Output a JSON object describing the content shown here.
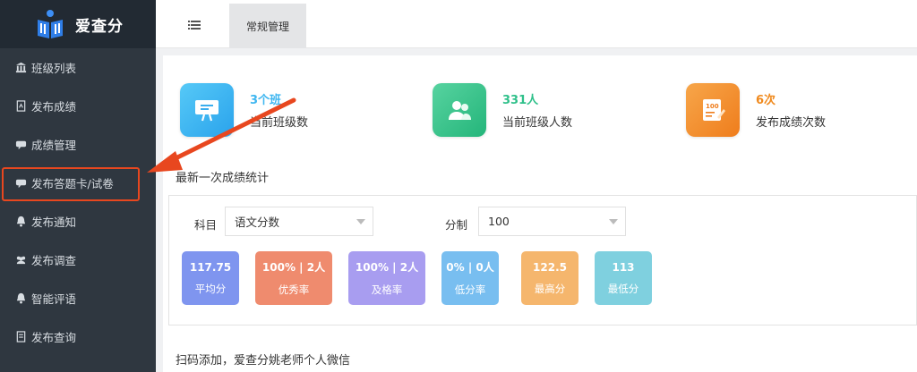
{
  "app": {
    "name": "爱查分"
  },
  "sidebar": {
    "items": [
      {
        "label": "班级列表",
        "icon": "bank-icon"
      },
      {
        "label": "发布成绩",
        "icon": "document-icon"
      },
      {
        "label": "成绩管理",
        "icon": "speech-bubble-icon"
      },
      {
        "label": "发布答题卡/试卷",
        "icon": "speech-bubble-icon",
        "highlighted": true
      },
      {
        "label": "发布通知",
        "icon": "bell-icon"
      },
      {
        "label": "发布调查",
        "icon": "users-icon"
      },
      {
        "label": "智能评语",
        "icon": "bell-icon"
      },
      {
        "label": "发布查询",
        "icon": "file-icon"
      }
    ]
  },
  "topbar": {
    "active_tab": "常规管理"
  },
  "summary": [
    {
      "value": "3个班",
      "label": "当前班级数",
      "color": "#3eb6f0"
    },
    {
      "value": "331人",
      "label": "当前班级人数",
      "color": "#2fc08a"
    },
    {
      "value": "6次",
      "label": "发布成绩次数",
      "color": "#f08a1e"
    }
  ],
  "latest": {
    "title": "最新一次成绩统计",
    "subject_label": "科目",
    "subject_value": "语文分数",
    "scale_label": "分制",
    "scale_value": "100",
    "badges": [
      {
        "value": "117.75",
        "label": "平均分",
        "color": "#7f95ef"
      },
      {
        "value": "100% | 2人",
        "label": "优秀率",
        "color": "#ef8b6e"
      },
      {
        "value": "100% | 2人",
        "label": "及格率",
        "color": "#a89df0"
      },
      {
        "value": "0% | 0人",
        "label": "低分率",
        "color": "#78bef0"
      },
      {
        "value": "122.5",
        "label": "最高分",
        "color": "#f5b66d"
      },
      {
        "value": "113",
        "label": "最低分",
        "color": "#7fd0df"
      }
    ]
  },
  "footer_section": {
    "title": "扫码添加，爱查分姚老师个人微信"
  },
  "colors": {
    "sidebar_bg": "#2f3740",
    "highlight_border": "#e8471f",
    "arrow": "#e8471f"
  }
}
